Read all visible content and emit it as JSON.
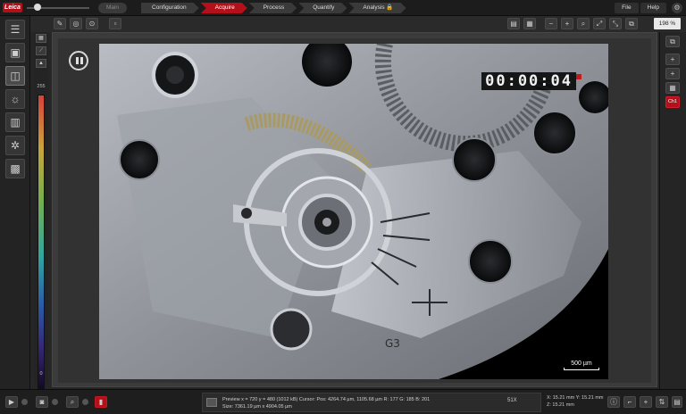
{
  "app": {
    "logo_text": "Leica"
  },
  "topbar": {
    "mode": "Main",
    "workflow": [
      {
        "label": "Configuration",
        "active": false
      },
      {
        "label": "Acquire",
        "active": true
      },
      {
        "label": "Process",
        "active": false
      },
      {
        "label": "Quantify",
        "active": false
      },
      {
        "label": "Analysis 🔒",
        "active": false
      }
    ],
    "menu": {
      "file": "File",
      "help": "Help"
    }
  },
  "toolbar": {
    "zoom": "198 %"
  },
  "lut": {
    "max": "255",
    "min": "0"
  },
  "viewer": {
    "timer": "00:00:04",
    "scalebar": "500 µm"
  },
  "rsidebar": {
    "channel": "Ch1"
  },
  "status": {
    "line1": "Preview  x = 720  y = 480  (1012 kB)   Cursor:  Pos: 4264.74 µm, 1105.68 µm   R: 177  G: 185  B: 201",
    "line2": "Size: 7361.19 µm x 4904.05 µm",
    "magnification": "51X",
    "coord_x": "X: 15.21 mm  Y: 15.21 mm",
    "coord_z": "Z: 15.21 mm"
  },
  "colors": {
    "accent": "#b3101a",
    "background": "#262626"
  }
}
